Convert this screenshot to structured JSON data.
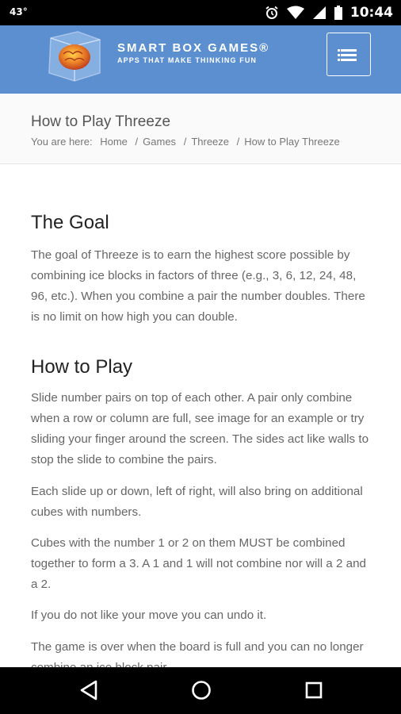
{
  "status_bar": {
    "temperature": "43°",
    "time": "10:44"
  },
  "header": {
    "brand_title": "SMART BOX GAMES®",
    "brand_tagline": "APPS THAT MAKE THINKING FUN"
  },
  "page": {
    "title": "How to Play Threeze",
    "breadcrumb": {
      "prefix": "You are here:",
      "items": [
        "Home",
        "Games",
        "Threeze",
        "How to Play Threeze"
      ],
      "separator": "/"
    }
  },
  "content": {
    "goal_heading": "The Goal",
    "goal_text": "The goal of Threeze is to earn the highest score possible by combining ice blocks in factors of three (e.g., 3, 6, 12, 24, 48, 96, etc.). When you combine a pair the number doubles. There is no limit on how high you can double.",
    "howto_heading": "How to Play",
    "paragraphs": [
      "Slide number pairs on top of each other. A pair only combine when a row or column are full, see image for an example or try sliding your finger around the screen. The sides act like walls to stop the slide to combine the pairs.",
      "Each slide up or down, left of right, will also bring on additional cubes with numbers.",
      "Cubes with the number 1 or 2 on them MUST be combined together to form a 3. A 1 and 1 will not combine nor will a 2 and a 2.",
      "If you do not like your move you can undo it.",
      "The game is over when the board is full and you can no longer combine an ice block pair."
    ]
  },
  "colors": {
    "header_bg": "#5b8fd0",
    "title_bg": "#fafafa",
    "text": "#666666"
  },
  "icons": {
    "status": [
      "alarm-icon",
      "wifi-icon",
      "signal-icon",
      "battery-icon"
    ],
    "nav": [
      "back-icon",
      "home-icon",
      "recents-icon"
    ],
    "menu": "hamburger-menu-icon"
  }
}
